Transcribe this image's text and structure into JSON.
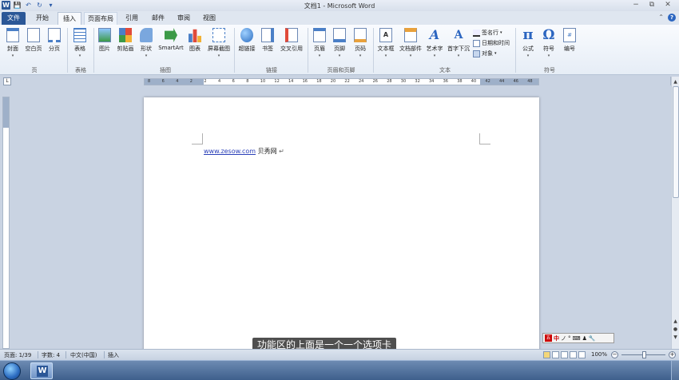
{
  "window": {
    "title": "文档1 - Microsoft Word",
    "controls": [
      "−",
      "⧉",
      "✕"
    ]
  },
  "quick_access": [
    "save-icon",
    "undo-icon",
    "redo-icon",
    "customize-icon"
  ],
  "tabs": [
    {
      "label": "文件"
    },
    {
      "label": "开始"
    },
    {
      "label": "插入"
    },
    {
      "label": "页面布局"
    },
    {
      "label": "引用"
    },
    {
      "label": "邮件"
    },
    {
      "label": "审阅"
    },
    {
      "label": "视图"
    }
  ],
  "active_tab": "插入",
  "ribbon": {
    "pages": {
      "label": "页",
      "buttons": [
        "封面",
        "空白页",
        "分页"
      ]
    },
    "tables": {
      "label": "表格",
      "buttons": [
        "表格"
      ]
    },
    "illustrations": {
      "label": "插图",
      "buttons": [
        "图片",
        "剪贴画",
        "形状",
        "SmartArt",
        "图表",
        "屏幕截图"
      ]
    },
    "links": {
      "label": "链接",
      "buttons": [
        "超链接",
        "书签",
        "交叉引用"
      ]
    },
    "header_footer": {
      "label": "页眉和页脚",
      "buttons": [
        "页眉",
        "页脚",
        "页码"
      ]
    },
    "text": {
      "label": "文本",
      "buttons": [
        "文本框",
        "文档部件",
        "艺术字",
        "首字下沉"
      ],
      "small": [
        "签名行",
        "日期和时间",
        "对象"
      ]
    },
    "symbols": {
      "label": "符号",
      "buttons": [
        "公式",
        "符号",
        "编号"
      ]
    }
  },
  "ruler": {
    "ticks": [
      "8",
      "6",
      "4",
      "2",
      "2",
      "4",
      "6",
      "8",
      "10",
      "12",
      "14",
      "16",
      "18",
      "20",
      "22",
      "24",
      "26",
      "28",
      "30",
      "32",
      "34",
      "36",
      "38",
      "40",
      "42",
      "44",
      "46",
      "48"
    ]
  },
  "document": {
    "link_text": "www.zesow.com",
    "text": "贝秀网",
    "mark": "↵"
  },
  "ime": {
    "items": [
      "中",
      "ノ",
      "°",
      "⌨",
      "♟",
      "🔧"
    ]
  },
  "subtitle": "功能区的上面是一个一个选项卡",
  "status": {
    "page": "页面: 1/39",
    "words": "字数: 4",
    "language": "中文(中国)",
    "mode": "插入",
    "zoom": "100%",
    "zoom_level": 100
  }
}
